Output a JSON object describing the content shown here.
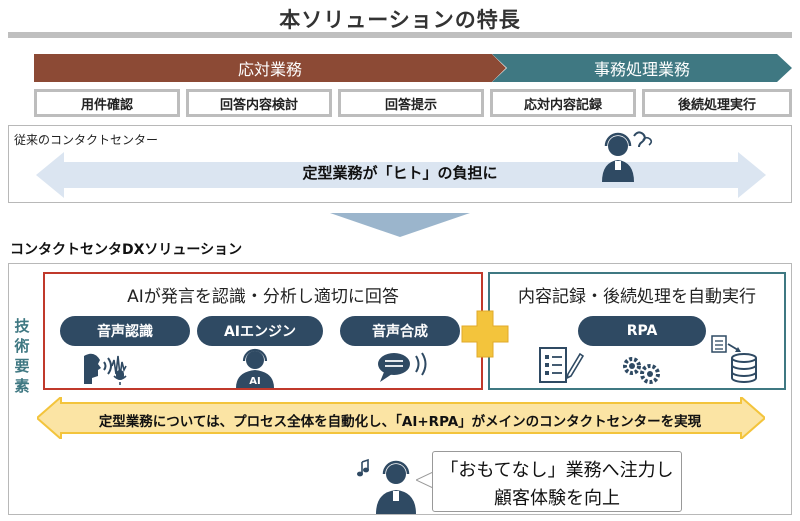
{
  "title": "本ソリューションの特長",
  "phases": [
    {
      "label": "応対業務",
      "color": "#8c4a35"
    },
    {
      "label": "事務処理業務",
      "color": "#3f7882"
    }
  ],
  "steps": [
    "用件確認",
    "回答内容検討",
    "回答提示",
    "応対内容記録",
    "後続処理実行"
  ],
  "traditional": {
    "label": "従来のコンタクトセンター",
    "arrow_text": "定型業務が「ヒト」の負担に"
  },
  "dx": {
    "label": "コンタクトセンタDXソリューション",
    "tech_label": "技術要素",
    "ai_box": {
      "title": "AIが発言を認識・分析し適切に回答",
      "pills": [
        "音声認識",
        "AIエンジン",
        "音声合成"
      ],
      "ai_badge": "AI"
    },
    "rpa_box": {
      "title": "内容記録・後続処理を自動実行",
      "pill": "RPA"
    },
    "arrow_text": "定型業務については、プロセス全体を自動化し、「AI+RPA」がメインのコンタクトセンターを実現",
    "omotenashi": {
      "line1": "「おもてなし」業務へ注力し",
      "line2": "顧客体験を向上"
    }
  },
  "icons": [
    "operator-thinking-icon",
    "voice-recognition-icon",
    "ai-operator-icon",
    "speech-bubble-icon",
    "checklist-icon",
    "gears-icon",
    "database-icon",
    "operator-music-icon"
  ],
  "colors": {
    "red_box": "#c0392b",
    "teal": "#3f7882",
    "gold": "#f3c43c",
    "pill": "#2f4a63"
  }
}
